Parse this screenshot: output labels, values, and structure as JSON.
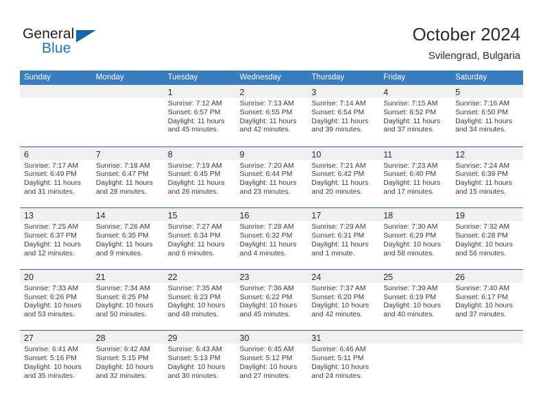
{
  "brand": {
    "name_top": "General",
    "name_bottom": "Blue",
    "triangle_color": "#1467ad",
    "text_color": "#231f20",
    "blue_text_color": "#1f72bd"
  },
  "header": {
    "title": "October 2024",
    "subtitle": "Svilengrad, Bulgaria"
  },
  "theme": {
    "header_blue": "#3a7dbf",
    "row_divider_blue": "#1d6cb3",
    "day_strip_gray": "#f0f0f0",
    "body_text": "#3a3a3a"
  },
  "weekdays": [
    "Sunday",
    "Monday",
    "Tuesday",
    "Wednesday",
    "Thursday",
    "Friday",
    "Saturday"
  ],
  "weeks": [
    [
      {
        "day": "",
        "empty": true,
        "sunrise": "",
        "sunset": "",
        "daylight_line1": "",
        "daylight_line2": ""
      },
      {
        "day": "",
        "empty": true,
        "sunrise": "",
        "sunset": "",
        "daylight_line1": "",
        "daylight_line2": ""
      },
      {
        "day": "1",
        "empty": false,
        "sunrise": "Sunrise: 7:12 AM",
        "sunset": "Sunset: 6:57 PM",
        "daylight_line1": "Daylight: 11 hours",
        "daylight_line2": "and 45 minutes."
      },
      {
        "day": "2",
        "empty": false,
        "sunrise": "Sunrise: 7:13 AM",
        "sunset": "Sunset: 6:55 PM",
        "daylight_line1": "Daylight: 11 hours",
        "daylight_line2": "and 42 minutes."
      },
      {
        "day": "3",
        "empty": false,
        "sunrise": "Sunrise: 7:14 AM",
        "sunset": "Sunset: 6:54 PM",
        "daylight_line1": "Daylight: 11 hours",
        "daylight_line2": "and 39 minutes."
      },
      {
        "day": "4",
        "empty": false,
        "sunrise": "Sunrise: 7:15 AM",
        "sunset": "Sunset: 6:52 PM",
        "daylight_line1": "Daylight: 11 hours",
        "daylight_line2": "and 37 minutes."
      },
      {
        "day": "5",
        "empty": false,
        "sunrise": "Sunrise: 7:16 AM",
        "sunset": "Sunset: 6:50 PM",
        "daylight_line1": "Daylight: 11 hours",
        "daylight_line2": "and 34 minutes."
      }
    ],
    [
      {
        "day": "6",
        "empty": false,
        "sunrise": "Sunrise: 7:17 AM",
        "sunset": "Sunset: 6:49 PM",
        "daylight_line1": "Daylight: 11 hours",
        "daylight_line2": "and 31 minutes."
      },
      {
        "day": "7",
        "empty": false,
        "sunrise": "Sunrise: 7:18 AM",
        "sunset": "Sunset: 6:47 PM",
        "daylight_line1": "Daylight: 11 hours",
        "daylight_line2": "and 28 minutes."
      },
      {
        "day": "8",
        "empty": false,
        "sunrise": "Sunrise: 7:19 AM",
        "sunset": "Sunset: 6:45 PM",
        "daylight_line1": "Daylight: 11 hours",
        "daylight_line2": "and 26 minutes."
      },
      {
        "day": "9",
        "empty": false,
        "sunrise": "Sunrise: 7:20 AM",
        "sunset": "Sunset: 6:44 PM",
        "daylight_line1": "Daylight: 11 hours",
        "daylight_line2": "and 23 minutes."
      },
      {
        "day": "10",
        "empty": false,
        "sunrise": "Sunrise: 7:21 AM",
        "sunset": "Sunset: 6:42 PM",
        "daylight_line1": "Daylight: 11 hours",
        "daylight_line2": "and 20 minutes."
      },
      {
        "day": "11",
        "empty": false,
        "sunrise": "Sunrise: 7:23 AM",
        "sunset": "Sunset: 6:40 PM",
        "daylight_line1": "Daylight: 11 hours",
        "daylight_line2": "and 17 minutes."
      },
      {
        "day": "12",
        "empty": false,
        "sunrise": "Sunrise: 7:24 AM",
        "sunset": "Sunset: 6:39 PM",
        "daylight_line1": "Daylight: 11 hours",
        "daylight_line2": "and 15 minutes."
      }
    ],
    [
      {
        "day": "13",
        "empty": false,
        "sunrise": "Sunrise: 7:25 AM",
        "sunset": "Sunset: 6:37 PM",
        "daylight_line1": "Daylight: 11 hours",
        "daylight_line2": "and 12 minutes."
      },
      {
        "day": "14",
        "empty": false,
        "sunrise": "Sunrise: 7:26 AM",
        "sunset": "Sunset: 6:35 PM",
        "daylight_line1": "Daylight: 11 hours",
        "daylight_line2": "and 9 minutes."
      },
      {
        "day": "15",
        "empty": false,
        "sunrise": "Sunrise: 7:27 AM",
        "sunset": "Sunset: 6:34 PM",
        "daylight_line1": "Daylight: 11 hours",
        "daylight_line2": "and 6 minutes."
      },
      {
        "day": "16",
        "empty": false,
        "sunrise": "Sunrise: 7:28 AM",
        "sunset": "Sunset: 6:32 PM",
        "daylight_line1": "Daylight: 11 hours",
        "daylight_line2": "and 4 minutes."
      },
      {
        "day": "17",
        "empty": false,
        "sunrise": "Sunrise: 7:29 AM",
        "sunset": "Sunset: 6:31 PM",
        "daylight_line1": "Daylight: 11 hours",
        "daylight_line2": "and 1 minute."
      },
      {
        "day": "18",
        "empty": false,
        "sunrise": "Sunrise: 7:30 AM",
        "sunset": "Sunset: 6:29 PM",
        "daylight_line1": "Daylight: 10 hours",
        "daylight_line2": "and 58 minutes."
      },
      {
        "day": "19",
        "empty": false,
        "sunrise": "Sunrise: 7:32 AM",
        "sunset": "Sunset: 6:28 PM",
        "daylight_line1": "Daylight: 10 hours",
        "daylight_line2": "and 56 minutes."
      }
    ],
    [
      {
        "day": "20",
        "empty": false,
        "sunrise": "Sunrise: 7:33 AM",
        "sunset": "Sunset: 6:26 PM",
        "daylight_line1": "Daylight: 10 hours",
        "daylight_line2": "and 53 minutes."
      },
      {
        "day": "21",
        "empty": false,
        "sunrise": "Sunrise: 7:34 AM",
        "sunset": "Sunset: 6:25 PM",
        "daylight_line1": "Daylight: 10 hours",
        "daylight_line2": "and 50 minutes."
      },
      {
        "day": "22",
        "empty": false,
        "sunrise": "Sunrise: 7:35 AM",
        "sunset": "Sunset: 6:23 PM",
        "daylight_line1": "Daylight: 10 hours",
        "daylight_line2": "and 48 minutes."
      },
      {
        "day": "23",
        "empty": false,
        "sunrise": "Sunrise: 7:36 AM",
        "sunset": "Sunset: 6:22 PM",
        "daylight_line1": "Daylight: 10 hours",
        "daylight_line2": "and 45 minutes."
      },
      {
        "day": "24",
        "empty": false,
        "sunrise": "Sunrise: 7:37 AM",
        "sunset": "Sunset: 6:20 PM",
        "daylight_line1": "Daylight: 10 hours",
        "daylight_line2": "and 42 minutes."
      },
      {
        "day": "25",
        "empty": false,
        "sunrise": "Sunrise: 7:39 AM",
        "sunset": "Sunset: 6:19 PM",
        "daylight_line1": "Daylight: 10 hours",
        "daylight_line2": "and 40 minutes."
      },
      {
        "day": "26",
        "empty": false,
        "sunrise": "Sunrise: 7:40 AM",
        "sunset": "Sunset: 6:17 PM",
        "daylight_line1": "Daylight: 10 hours",
        "daylight_line2": "and 37 minutes."
      }
    ],
    [
      {
        "day": "27",
        "empty": false,
        "sunrise": "Sunrise: 6:41 AM",
        "sunset": "Sunset: 5:16 PM",
        "daylight_line1": "Daylight: 10 hours",
        "daylight_line2": "and 35 minutes."
      },
      {
        "day": "28",
        "empty": false,
        "sunrise": "Sunrise: 6:42 AM",
        "sunset": "Sunset: 5:15 PM",
        "daylight_line1": "Daylight: 10 hours",
        "daylight_line2": "and 32 minutes."
      },
      {
        "day": "29",
        "empty": false,
        "sunrise": "Sunrise: 6:43 AM",
        "sunset": "Sunset: 5:13 PM",
        "daylight_line1": "Daylight: 10 hours",
        "daylight_line2": "and 30 minutes."
      },
      {
        "day": "30",
        "empty": false,
        "sunrise": "Sunrise: 6:45 AM",
        "sunset": "Sunset: 5:12 PM",
        "daylight_line1": "Daylight: 10 hours",
        "daylight_line2": "and 27 minutes."
      },
      {
        "day": "31",
        "empty": false,
        "sunrise": "Sunrise: 6:46 AM",
        "sunset": "Sunset: 5:11 PM",
        "daylight_line1": "Daylight: 10 hours",
        "daylight_line2": "and 24 minutes."
      },
      {
        "day": "",
        "empty": true,
        "sunrise": "",
        "sunset": "",
        "daylight_line1": "",
        "daylight_line2": ""
      },
      {
        "day": "",
        "empty": true,
        "sunrise": "",
        "sunset": "",
        "daylight_line1": "",
        "daylight_line2": ""
      }
    ]
  ]
}
